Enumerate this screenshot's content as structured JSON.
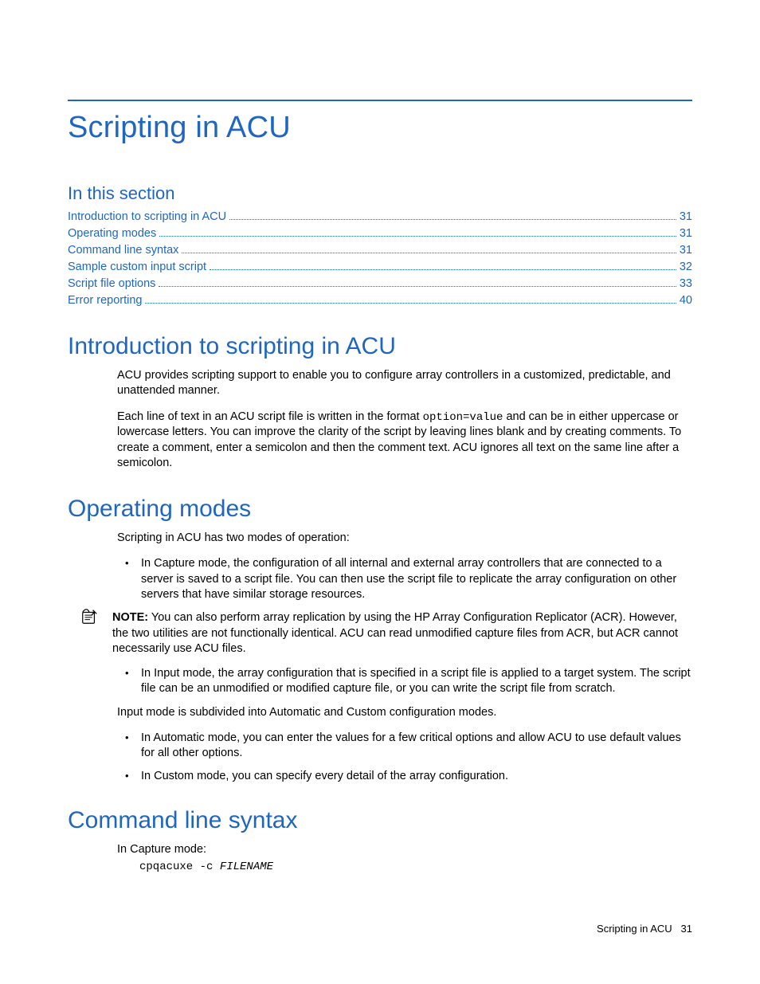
{
  "title": "Scripting in ACU",
  "in_this_section_heading": "In this section",
  "toc": [
    {
      "label": "Introduction to scripting in ACU",
      "page": "31"
    },
    {
      "label": "Operating modes",
      "page": "31"
    },
    {
      "label": "Command line syntax",
      "page": "31"
    },
    {
      "label": "Sample custom input script",
      "page": "32"
    },
    {
      "label": "Script file options",
      "page": "33"
    },
    {
      "label": "Error reporting",
      "page": "40"
    }
  ],
  "sections": {
    "intro": {
      "heading": "Introduction to scripting in ACU",
      "p1": "ACU provides scripting support to enable you to configure array controllers in a customized, predictable, and unattended manner.",
      "p2a": "Each line of text in an ACU script file is written in the format ",
      "p2_code": "option=value",
      "p2b": " and can be in either uppercase or lowercase letters. You can improve the clarity of the script by leaving lines blank and by creating comments. To create a comment, enter a semicolon and then the comment text. ACU ignores all text on the same line after a semicolon."
    },
    "modes": {
      "heading": "Operating modes",
      "lead": "Scripting in ACU has two modes of operation:",
      "b1": "In Capture mode, the configuration of all internal and external array controllers that are connected to a server is saved to a script file. You can then use the script file to replicate the array configuration on other servers that have similar storage resources.",
      "note_label": "NOTE:",
      "note_body": "  You can also perform array replication by using the HP Array Configuration Replicator (ACR). However, the two utilities are not functionally identical. ACU can read unmodified capture files from ACR, but ACR cannot necessarily use ACU files.",
      "b2": "In Input mode, the array configuration that is specified in a script file is applied to a target system. The script file can be an unmodified or modified capture file, or you can write the script file from scratch.",
      "sub_lead": "Input mode is subdivided into Automatic and Custom configuration modes.",
      "sb1": "In Automatic mode, you can enter the values for a few critical options and allow ACU to use default values for all other options.",
      "sb2": "In Custom mode, you can specify every detail of the array configuration."
    },
    "cmd": {
      "heading": "Command line syntax",
      "lead": "In Capture mode:",
      "cmd_fixed": "cpqacuxe -c ",
      "cmd_arg": "FILENAME"
    }
  },
  "footer": {
    "label": "Scripting in ACU",
    "page": "31"
  }
}
